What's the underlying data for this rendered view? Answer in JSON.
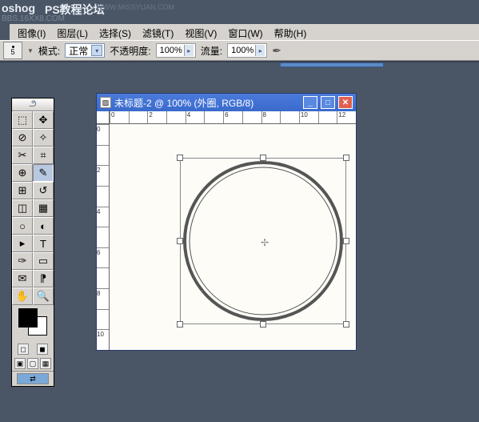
{
  "watermark": {
    "title": "PS教程论坛",
    "sub": "BBS.16XX8.COM",
    "url": "WWW.MISSYUAN.COM"
  },
  "app_logo": "oshog",
  "menu": {
    "image": "图像(I)",
    "layer": "图层(L)",
    "select": "选择(S)",
    "filter": "滤镜(T)",
    "view": "视图(V)",
    "window": "窗口(W)",
    "help": "帮助(H)"
  },
  "options": {
    "brush_size": "5",
    "mode_label": "模式:",
    "mode_value": "正常",
    "opacity_label": "不透明度:",
    "opacity_value": "100%",
    "flow_label": "流量:",
    "flow_value": "100%"
  },
  "document": {
    "title": "未标题-2 @ 100% (外圈, RGB/8)"
  },
  "ruler_h": [
    "0",
    "",
    "2",
    "",
    "4",
    "",
    "6",
    "",
    "8",
    "",
    "10",
    "",
    "12"
  ],
  "ruler_v": [
    "0",
    "",
    "2",
    "",
    "4",
    "",
    "6",
    "",
    "8",
    "",
    "10"
  ]
}
